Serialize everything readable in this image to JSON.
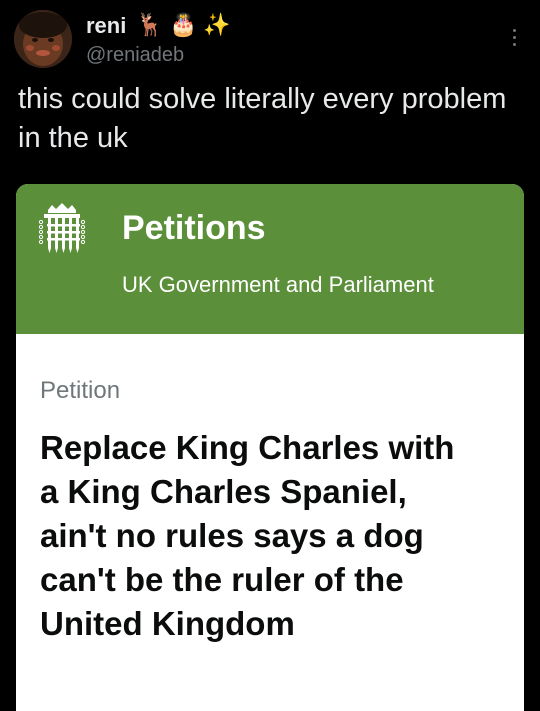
{
  "tweet": {
    "display_name": "reni",
    "name_emojis": [
      "🦌",
      "🎂",
      "✨"
    ],
    "handle": "@reniadeb",
    "text": "this could solve literally every problem in the uk",
    "more_icon": "more-dots-vertical-icon"
  },
  "card": {
    "header_title": "Petitions",
    "header_subtitle": "UK Government and Parliament",
    "header_icon": "portcullis-icon",
    "label": "Petition",
    "title": "Replace King Charles with a King Charles Spaniel, ain't no rules says a dog can't be the ruler of the United Kingdom"
  },
  "colors": {
    "background": "#000000",
    "text_primary": "#e7e9ea",
    "text_secondary": "#71767b",
    "petition_green": "#5b8f3a",
    "card_body": "#ffffff",
    "petition_title": "#0b0c0c",
    "petition_label": "#6f777b"
  }
}
